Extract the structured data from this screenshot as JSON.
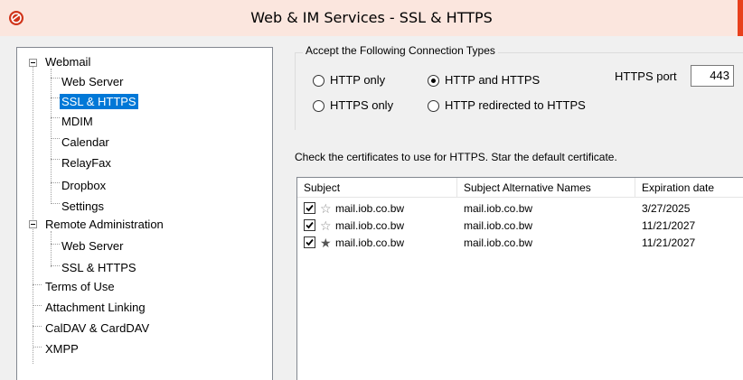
{
  "window": {
    "title": "Web & IM Services - SSL & HTTPS",
    "accent_color": "#e8401c",
    "icon": "app-logo-icon"
  },
  "tree": {
    "items": [
      {
        "label": "Webmail",
        "level": 0,
        "expander": true
      },
      {
        "label": "Web Server",
        "level": 1
      },
      {
        "label": "SSL & HTTPS",
        "level": 1,
        "selected": true
      },
      {
        "label": "MDIM",
        "level": 1
      },
      {
        "label": "Calendar",
        "level": 1
      },
      {
        "label": "RelayFax",
        "level": 1
      },
      {
        "label": "Dropbox",
        "level": 1
      },
      {
        "label": "Settings",
        "level": 1
      },
      {
        "label": "Remote Administration",
        "level": 0,
        "expander": true
      },
      {
        "label": "Web Server",
        "level": 1
      },
      {
        "label": "SSL & HTTPS",
        "level": 1
      },
      {
        "label": "Terms of Use",
        "level": 0
      },
      {
        "label": "Attachment Linking",
        "level": 0
      },
      {
        "label": "CalDAV & CardDAV",
        "level": 0
      },
      {
        "label": "XMPP",
        "level": 0
      }
    ]
  },
  "connection": {
    "group_title": "Accept the Following Connection Types",
    "options": [
      {
        "label": "HTTP only",
        "checked": false
      },
      {
        "label": "HTTP and HTTPS",
        "checked": true
      },
      {
        "label": "HTTPS only",
        "checked": false
      },
      {
        "label": "HTTP redirected to HTTPS",
        "checked": false
      }
    ],
    "port_label": "HTTPS port",
    "port_value": "443"
  },
  "certificates": {
    "instruction": "Check the certificates to use for HTTPS.  Star the default certificate.",
    "columns": [
      "Subject",
      "Subject Alternative Names",
      "Expiration date"
    ],
    "rows": [
      {
        "checked": true,
        "starred": false,
        "subject": "mail.iob.co.bw",
        "san": "mail.iob.co.bw",
        "expires": "3/27/2025"
      },
      {
        "checked": true,
        "starred": false,
        "subject": "mail.iob.co.bw",
        "san": "mail.iob.co.bw",
        "expires": "11/21/2027"
      },
      {
        "checked": true,
        "starred": true,
        "subject": "mail.iob.co.bw",
        "san": "mail.iob.co.bw",
        "expires": "11/21/2027"
      }
    ]
  }
}
